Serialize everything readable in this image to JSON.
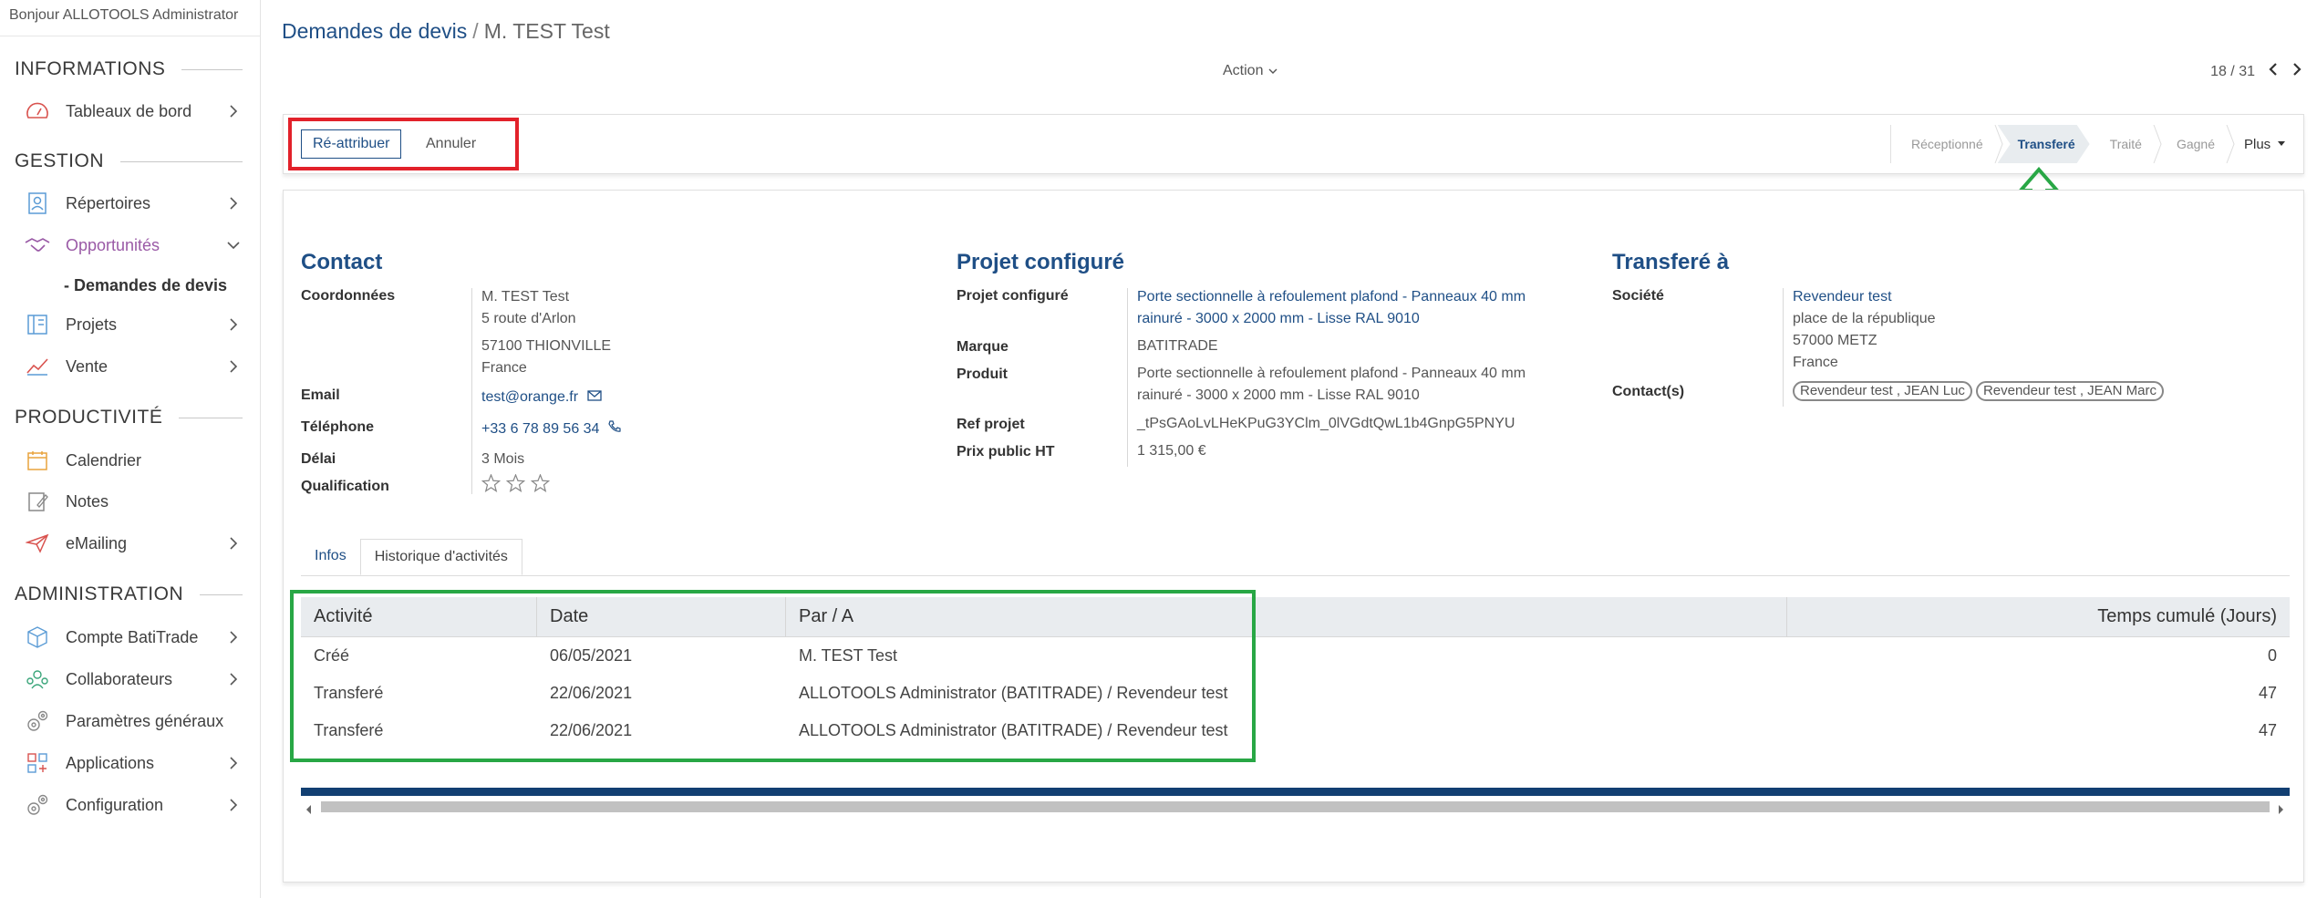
{
  "header": {
    "greeting": "Bonjour ALLOTOOLS Administrator"
  },
  "sidebar": {
    "sections": [
      {
        "title": "INFORMATIONS"
      },
      {
        "title": "GESTION"
      },
      {
        "title": "PRODUCTIVITÉ"
      },
      {
        "title": "ADMINISTRATION"
      }
    ],
    "items": {
      "tableaux": "Tableaux de bord",
      "repertoires": "Répertoires",
      "opportunites": "Opportunités",
      "demandes": "- Demandes de devis",
      "projets": "Projets",
      "vente": "Vente",
      "calendrier": "Calendrier",
      "notes": "Notes",
      "emailing": "eMailing",
      "compte": "Compte BatiTrade",
      "collaborateurs": "Collaborateurs",
      "parametres": "Paramètres généraux",
      "applications": "Applications",
      "configuration": "Configuration"
    },
    "accent": "#9a5aa6"
  },
  "breadcrumb": {
    "parent": "Demandes de devis",
    "separator": "/",
    "current": "M. TEST Test"
  },
  "toolbar": {
    "action_label": "Action",
    "pager": "18 / 31"
  },
  "status": {
    "reassign_label": "Ré-attribuer",
    "cancel_label": "Annuler",
    "stages": [
      "Réceptionné",
      "Transferé",
      "Traité",
      "Gagné"
    ],
    "active_stage": "Transferé",
    "plus_label": "Plus"
  },
  "contact": {
    "title": "Contact",
    "labels": {
      "coordonnees": "Coordonnées",
      "email": "Email",
      "telephone": "Téléphone",
      "delai": "Délai",
      "qualification": "Qualification"
    },
    "name": "M.  TEST  Test",
    "street": "5 route d'Arlon",
    "city": "57100  THIONVILLE",
    "country": "France",
    "email": "test@orange.fr",
    "phone": "+33 6 78 89 56 34",
    "delai": "3 Mois",
    "rating_stars": 0
  },
  "projet": {
    "title": "Projet configuré",
    "labels": {
      "projet": "Projet configuré",
      "marque": "Marque",
      "produit": "Produit",
      "ref": "Ref projet",
      "prix": "Prix public HT"
    },
    "projet_line1": "Porte sectionnelle à refoulement plafond - Panneaux 40 mm",
    "projet_line2": "rainuré - 3000 x 2000 mm - Lisse RAL 9010",
    "marque": "BATITRADE",
    "produit_line1": "Porte sectionnelle à refoulement plafond - Panneaux 40 mm",
    "produit_line2": "rainuré - 3000 x 2000 mm - Lisse RAL 9010",
    "ref": "_tPsGAoLvLHeKPuG3YClm_0lVGdtQwL1b4GnpG5PNYU",
    "prix": "1 315,00 €"
  },
  "transfere": {
    "title": "Transferé à",
    "labels": {
      "societe": "Société",
      "contacts": "Contact(s)"
    },
    "societe": "Revendeur test",
    "street": "place de la république",
    "city": "57000 METZ",
    "country": "France",
    "contact1": "Revendeur test , JEAN Luc",
    "contact2": "Revendeur test , JEAN Marc"
  },
  "tabs": {
    "infos": "Infos",
    "historique": "Historique d'activités"
  },
  "history": {
    "headers": {
      "activite": "Activité",
      "date": "Date",
      "par": "Par / A",
      "temps": "Temps cumulé (Jours)"
    },
    "rows": [
      {
        "activite": "Créé",
        "date": "06/05/2021",
        "par": "M. TEST Test",
        "temps": "0"
      },
      {
        "activite": "Transferé",
        "date": "22/06/2021",
        "par": "ALLOTOOLS Administrator (BATITRADE) / Revendeur test",
        "temps": "47"
      },
      {
        "activite": "Transferé",
        "date": "22/06/2021",
        "par": "ALLOTOOLS Administrator (BATITRADE) / Revendeur test",
        "temps": "47"
      }
    ]
  },
  "colors": {
    "brand": "#1f4f86",
    "highlight_red": "#e2212a",
    "highlight_green": "#28a745"
  }
}
